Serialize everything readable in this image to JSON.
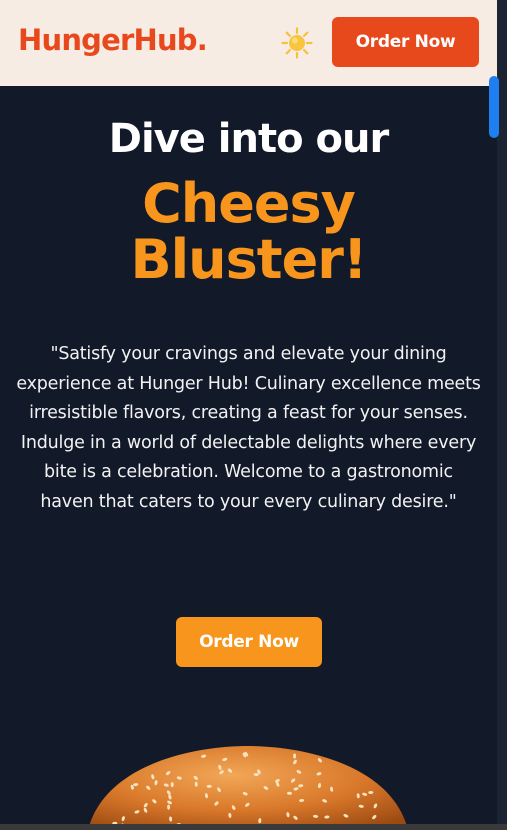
{
  "header": {
    "logo": "HungerHub.",
    "theme_icon": "sun-icon",
    "cta_label": "Order Now"
  },
  "hero": {
    "heading_line1": "Dive into our",
    "heading_highlight_line1": "Cheesy",
    "heading_highlight_line2": "Bluster!",
    "description": "\"Satisfy your cravings and elevate your dining experience at Hunger Hub! Culinary excellence meets irresistible flavors, creating a feast for your senses. Indulge in a world of delectable delights where every bite is a celebration. Welcome to a gastronomic haven that caters to your every culinary desire.\"",
    "cta_label": "Order Now",
    "image": "burger-bun-image"
  },
  "colors": {
    "brand": "#e8491c",
    "accent": "#f8951d",
    "header_bg": "#f6ece4",
    "page_bg": "#121929",
    "scroll_thumb": "#1f7ff0"
  }
}
